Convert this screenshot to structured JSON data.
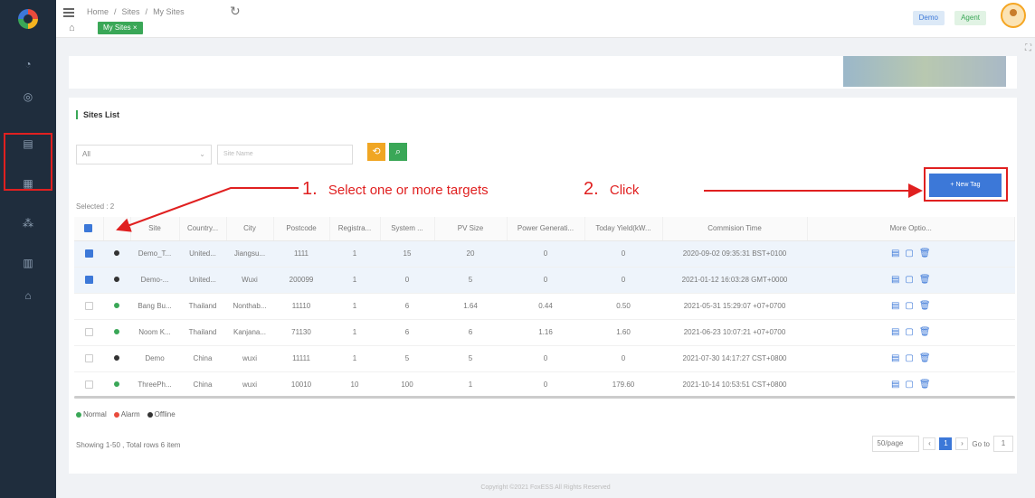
{
  "breadcrumb": [
    "Home",
    "/",
    "Sites",
    "/",
    "My Sites"
  ],
  "tab": "My Sites ×",
  "user": {
    "badge1": "Demo",
    "badge2": "Agent"
  },
  "card": {
    "title": "Sites List",
    "select_value": "All",
    "site_name_placeholder": "Site Name",
    "new_tag_label": "+ New Tag",
    "selected_label": "Selected : 2"
  },
  "table": {
    "headers": [
      "",
      "",
      "Site",
      "Country...",
      "City",
      "Postcode",
      "Registra...",
      "System ...",
      "PV Size",
      "Power Generati...",
      "Today Yield(kW...",
      "Commision Time",
      "More Optio..."
    ],
    "rows": [
      {
        "checked": true,
        "status": "#333333",
        "site": "Demo_T...",
        "country": "United...",
        "city": "Jiangsu...",
        "postcode": "1111",
        "reg": "1",
        "sys": "15",
        "pv": "20",
        "power": "0",
        "yield": "0",
        "time": "2020-09-02 09:35:31 BST+0100"
      },
      {
        "checked": true,
        "status": "#333333",
        "site": "Demo-...",
        "country": "United...",
        "city": "Wuxi",
        "postcode": "200099",
        "reg": "1",
        "sys": "0",
        "pv": "5",
        "power": "0",
        "yield": "0",
        "time": "2021-01-12 16:03:28 GMT+0000"
      },
      {
        "checked": false,
        "status": "#3aa757",
        "site": "Bang Bu...",
        "country": "Thailand",
        "city": "Nonthab...",
        "postcode": "11110",
        "reg": "1",
        "sys": "6",
        "pv": "1.64",
        "power": "0.44",
        "yield": "0.50",
        "time": "2021-05-31 15:29:07 +07+0700"
      },
      {
        "checked": false,
        "status": "#3aa757",
        "site": "Noom K...",
        "country": "Thailand",
        "city": "Kanjana...",
        "postcode": "71130",
        "reg": "1",
        "sys": "6",
        "pv": "6",
        "power": "1.16",
        "yield": "1.60",
        "time": "2021-06-23 10:07:21 +07+0700"
      },
      {
        "checked": false,
        "status": "#333333",
        "site": "Demo",
        "country": "China",
        "city": "wuxi",
        "postcode": "11111",
        "reg": "1",
        "sys": "5",
        "pv": "5",
        "power": "0",
        "yield": "0",
        "time": "2021-07-30 14:17:27 CST+0800"
      },
      {
        "checked": false,
        "status": "#3aa757",
        "site": "ThreePh...",
        "country": "China",
        "city": "wuxi",
        "postcode": "10010",
        "reg": "10",
        "sys": "100",
        "pv": "1",
        "power": "0",
        "yield": "179.60",
        "time": "2021-10-14 10:53:51 CST+0800"
      }
    ]
  },
  "legend": [
    {
      "label": "Normal",
      "color": "#3aa757"
    },
    {
      "label": "Alarm",
      "color": "#e94b3c"
    },
    {
      "label": "Offline",
      "color": "#333333"
    }
  ],
  "footer": {
    "showing": "Showing 1-50 , Total rows 6 item",
    "page_size": "50/page",
    "current_page": "1",
    "goto_label": "Go to",
    "goto_value": "1",
    "copyright": "Copyright ©2021 FoxESS All Rights Reserved"
  },
  "annotations": {
    "step1_num": "1.",
    "step1_text": "Select one or more targets",
    "step2_num": "2.",
    "step2_text": "Click"
  },
  "colors": {
    "accent_green": "#3aa757",
    "accent_blue": "#3c78d8",
    "annotation_red": "#e02020",
    "sidebar": "#1f2d3d"
  }
}
